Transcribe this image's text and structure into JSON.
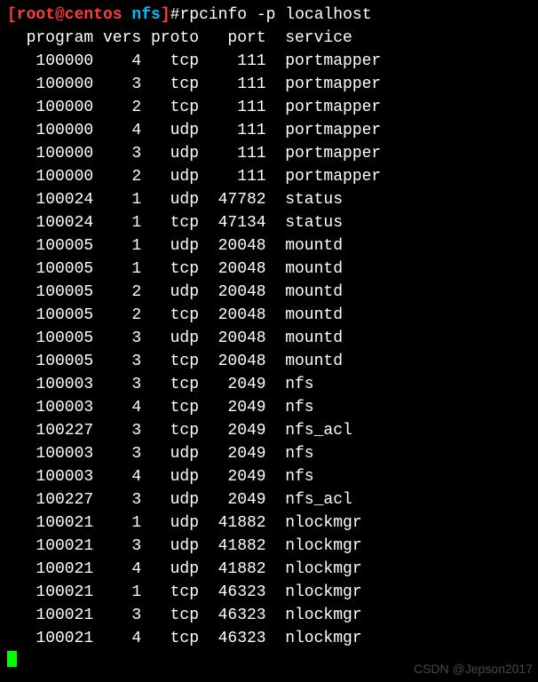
{
  "prompt": {
    "user_host": "[root@centos",
    "dir": " nfs",
    "close": "]",
    "hash": "#",
    "command": "rpcinfo -p localhost"
  },
  "headers": {
    "program": " program",
    "vers": " vers",
    "proto": " proto",
    "port": "   port",
    "service": "service"
  },
  "rows": [
    {
      "program": "100000",
      "vers": "4",
      "proto": "tcp",
      "port": "111",
      "service": "portmapper"
    },
    {
      "program": "100000",
      "vers": "3",
      "proto": "tcp",
      "port": "111",
      "service": "portmapper"
    },
    {
      "program": "100000",
      "vers": "2",
      "proto": "tcp",
      "port": "111",
      "service": "portmapper"
    },
    {
      "program": "100000",
      "vers": "4",
      "proto": "udp",
      "port": "111",
      "service": "portmapper"
    },
    {
      "program": "100000",
      "vers": "3",
      "proto": "udp",
      "port": "111",
      "service": "portmapper"
    },
    {
      "program": "100000",
      "vers": "2",
      "proto": "udp",
      "port": "111",
      "service": "portmapper"
    },
    {
      "program": "100024",
      "vers": "1",
      "proto": "udp",
      "port": "47782",
      "service": "status"
    },
    {
      "program": "100024",
      "vers": "1",
      "proto": "tcp",
      "port": "47134",
      "service": "status"
    },
    {
      "program": "100005",
      "vers": "1",
      "proto": "udp",
      "port": "20048",
      "service": "mountd"
    },
    {
      "program": "100005",
      "vers": "1",
      "proto": "tcp",
      "port": "20048",
      "service": "mountd"
    },
    {
      "program": "100005",
      "vers": "2",
      "proto": "udp",
      "port": "20048",
      "service": "mountd"
    },
    {
      "program": "100005",
      "vers": "2",
      "proto": "tcp",
      "port": "20048",
      "service": "mountd"
    },
    {
      "program": "100005",
      "vers": "3",
      "proto": "udp",
      "port": "20048",
      "service": "mountd"
    },
    {
      "program": "100005",
      "vers": "3",
      "proto": "tcp",
      "port": "20048",
      "service": "mountd"
    },
    {
      "program": "100003",
      "vers": "3",
      "proto": "tcp",
      "port": "2049",
      "service": "nfs"
    },
    {
      "program": "100003",
      "vers": "4",
      "proto": "tcp",
      "port": "2049",
      "service": "nfs"
    },
    {
      "program": "100227",
      "vers": "3",
      "proto": "tcp",
      "port": "2049",
      "service": "nfs_acl"
    },
    {
      "program": "100003",
      "vers": "3",
      "proto": "udp",
      "port": "2049",
      "service": "nfs"
    },
    {
      "program": "100003",
      "vers": "4",
      "proto": "udp",
      "port": "2049",
      "service": "nfs"
    },
    {
      "program": "100227",
      "vers": "3",
      "proto": "udp",
      "port": "2049",
      "service": "nfs_acl"
    },
    {
      "program": "100021",
      "vers": "1",
      "proto": "udp",
      "port": "41882",
      "service": "nlockmgr"
    },
    {
      "program": "100021",
      "vers": "3",
      "proto": "udp",
      "port": "41882",
      "service": "nlockmgr"
    },
    {
      "program": "100021",
      "vers": "4",
      "proto": "udp",
      "port": "41882",
      "service": "nlockmgr"
    },
    {
      "program": "100021",
      "vers": "1",
      "proto": "tcp",
      "port": "46323",
      "service": "nlockmgr"
    },
    {
      "program": "100021",
      "vers": "3",
      "proto": "tcp",
      "port": "46323",
      "service": "nlockmgr"
    },
    {
      "program": "100021",
      "vers": "4",
      "proto": "tcp",
      "port": "46323",
      "service": "nlockmgr"
    }
  ],
  "watermark": "CSDN @Jepson2017"
}
